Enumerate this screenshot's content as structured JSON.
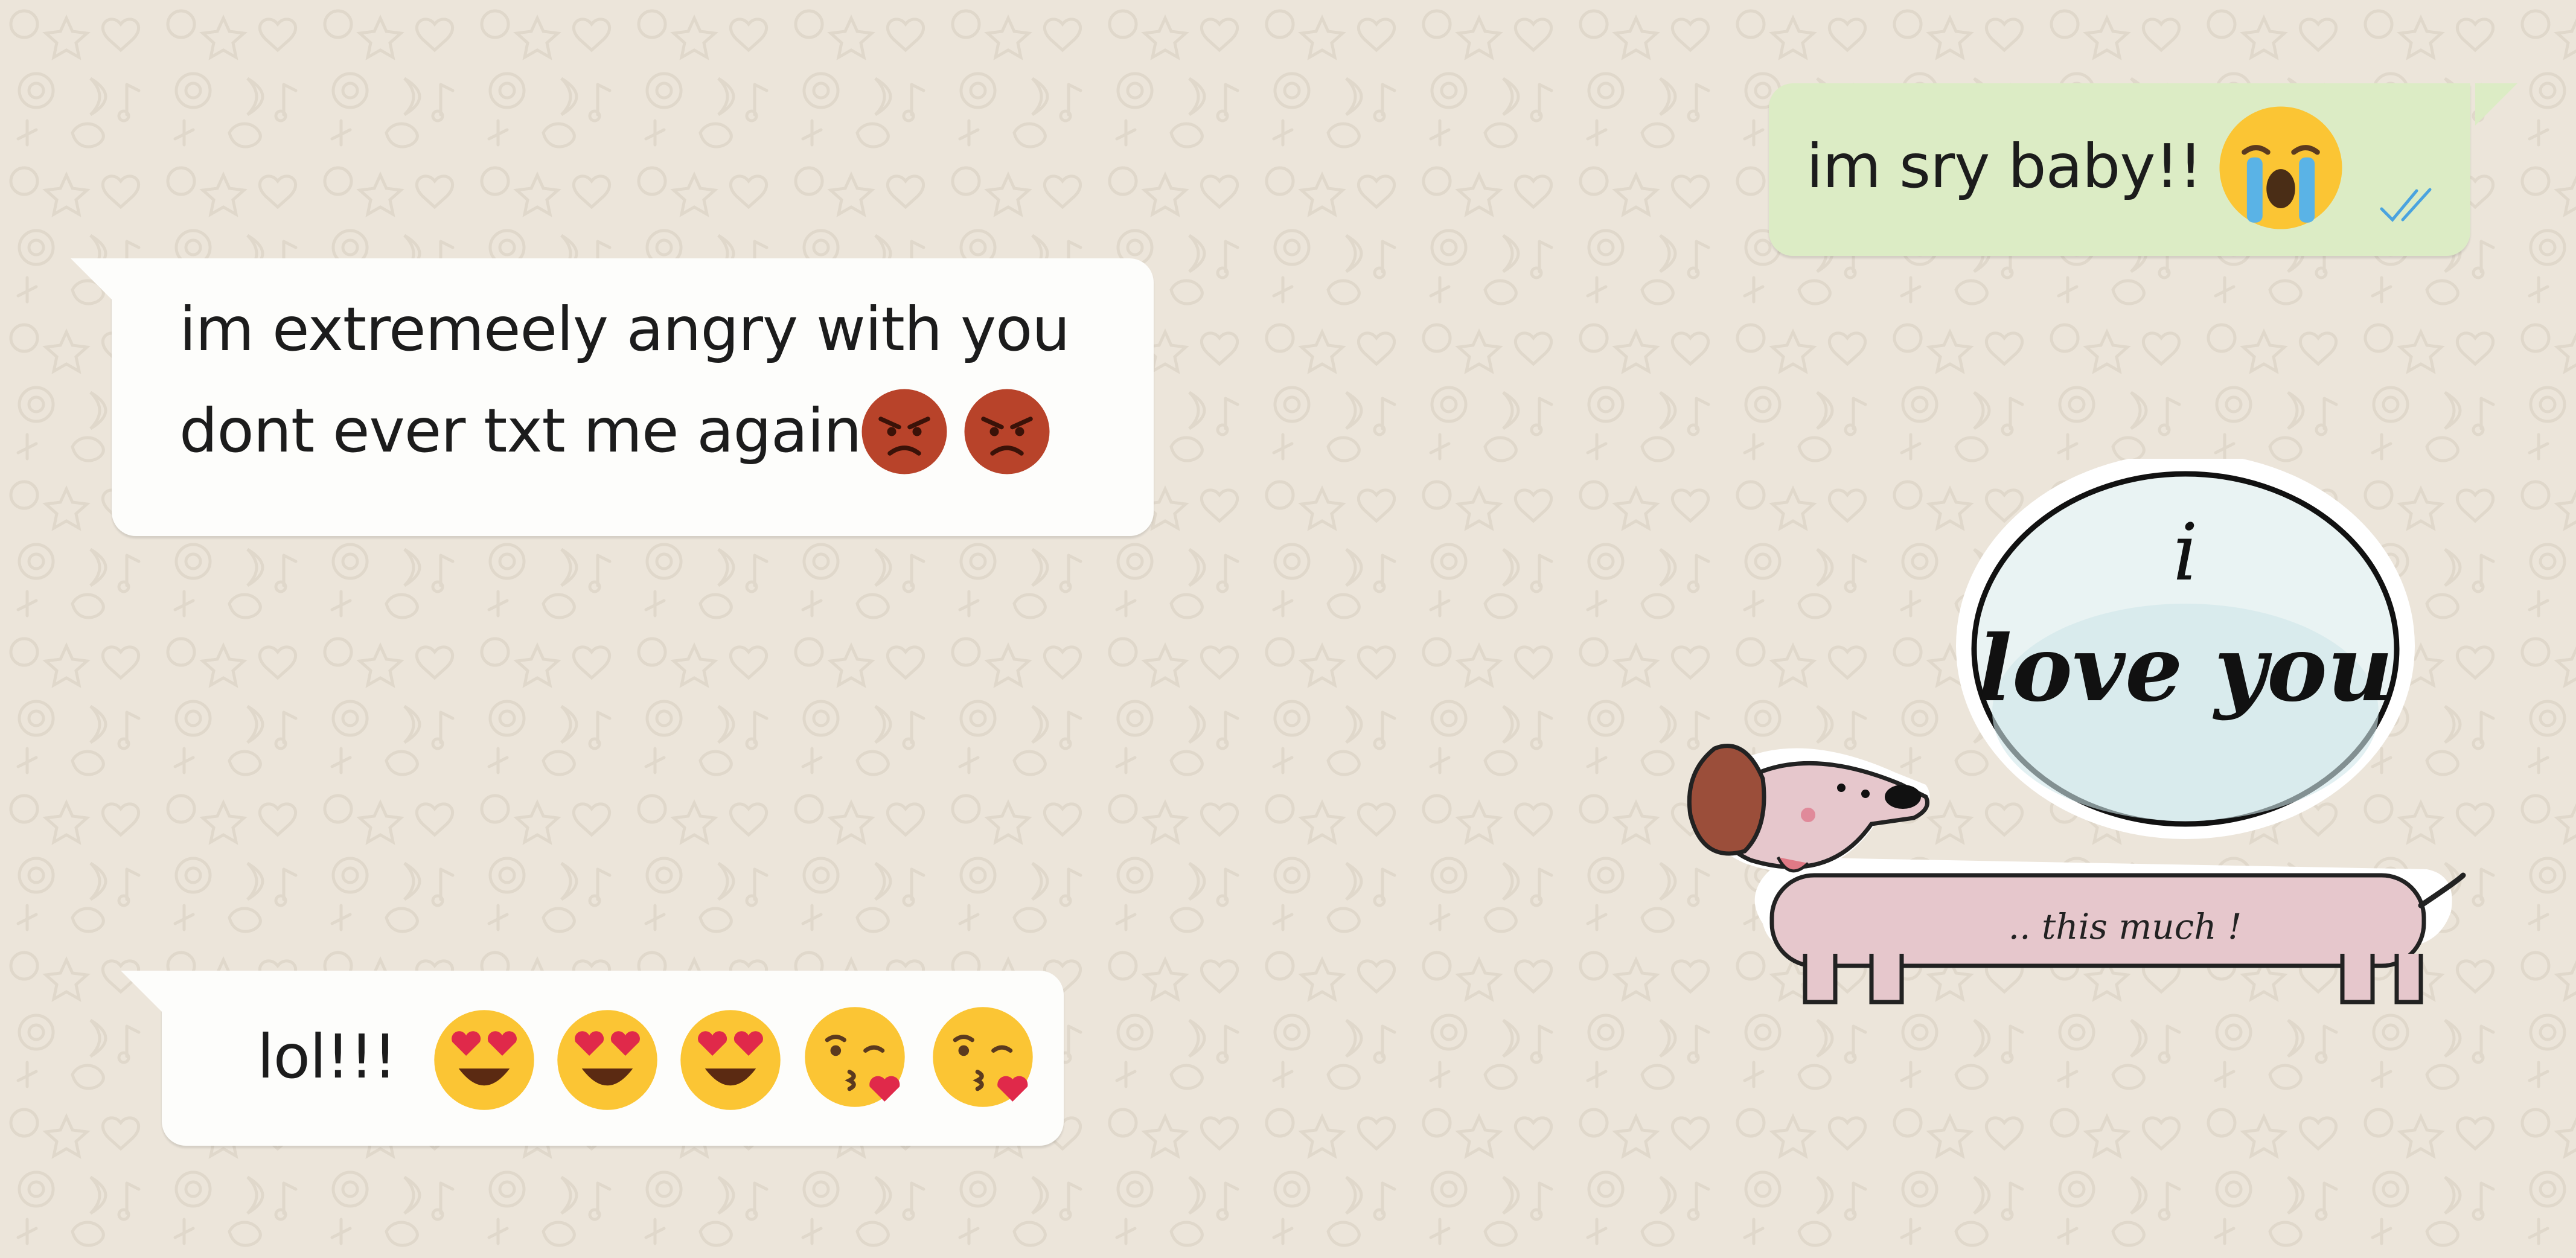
{
  "conversation": {
    "messages": [
      {
        "direction": "outgoing",
        "text": "im sry baby!!",
        "emoji": [
          "loudly-crying-face"
        ],
        "status": "read",
        "status_icon": "double-check-icon"
      },
      {
        "direction": "incoming",
        "lines": [
          "im extremeely angry with you",
          "dont ever txt me again"
        ],
        "emoji": [
          "angry-face",
          "angry-face"
        ]
      },
      {
        "direction": "outgoing",
        "type": "sticker",
        "sticker_text_1": "i",
        "sticker_text_2": "love you",
        "sticker_text_3": ".. this much !"
      },
      {
        "direction": "incoming",
        "text": "lol!!!",
        "emoji": [
          "heart-eyes-face",
          "heart-eyes-face",
          "heart-eyes-face",
          "kissing-heart-face",
          "kissing-heart-face"
        ]
      }
    ]
  },
  "colors": {
    "wallpaper": "#ece5da",
    "incoming_bubble": "#fdfdfb",
    "outgoing_bubble": "#dcecc5",
    "read_ticks": "#4aa3df"
  }
}
